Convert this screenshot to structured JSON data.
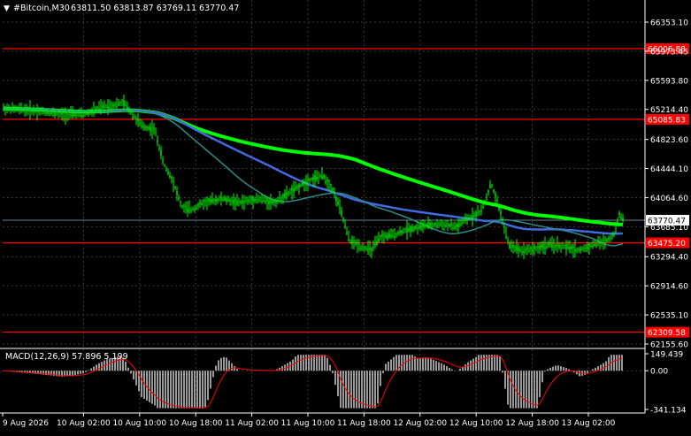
{
  "header": {
    "menu_glyph": "▼",
    "symbol": "#Bitcoin,M30",
    "ohlc": "63811.50 63813.87 63769.11 63770.47"
  },
  "colors": {
    "background": "#000000",
    "grid": "#3a3a3a",
    "axis_text": "#ffffff",
    "candle": "#00ff00",
    "ma_fast": "#2e8b8b",
    "ma_mid": "#4169e1",
    "ma_slow": "#00ff00",
    "level_line": "#ff0000",
    "current_price_line": "#708090",
    "macd_hist": "#c0c0c0",
    "macd_signal": "#ff0000"
  },
  "price_axis": {
    "ticks": [
      "66353.10",
      "65973.45",
      "65593.80",
      "65214.40",
      "64823.60",
      "64444.10",
      "64064.60",
      "63685.10",
      "63294.40",
      "62914.60",
      "62535.10",
      "62155.60"
    ]
  },
  "levels": [
    {
      "price": 66006.88,
      "label": "66006.88"
    },
    {
      "price": 65085.83,
      "label": "65085.83"
    },
    {
      "price": 63475.2,
      "label": "63475.20"
    },
    {
      "price": 62309.58,
      "label": "62309.58"
    }
  ],
  "current_price": {
    "price": 63770.47,
    "label": "63770.47"
  },
  "time_axis": {
    "ticks": [
      "9 Aug 2026",
      "10 Aug 02:00",
      "10 Aug 10:00",
      "10 Aug 18:00",
      "11 Aug 02:00",
      "11 Aug 10:00",
      "11 Aug 18:00",
      "12 Aug 02:00",
      "12 Aug 10:00",
      "12 Aug 18:00",
      "13 Aug 02:00"
    ]
  },
  "macd": {
    "label": "MACD(12,26,9) 57.896 5.199",
    "ticks": [
      "149.439",
      "0.00",
      "-341.134"
    ]
  }
}
